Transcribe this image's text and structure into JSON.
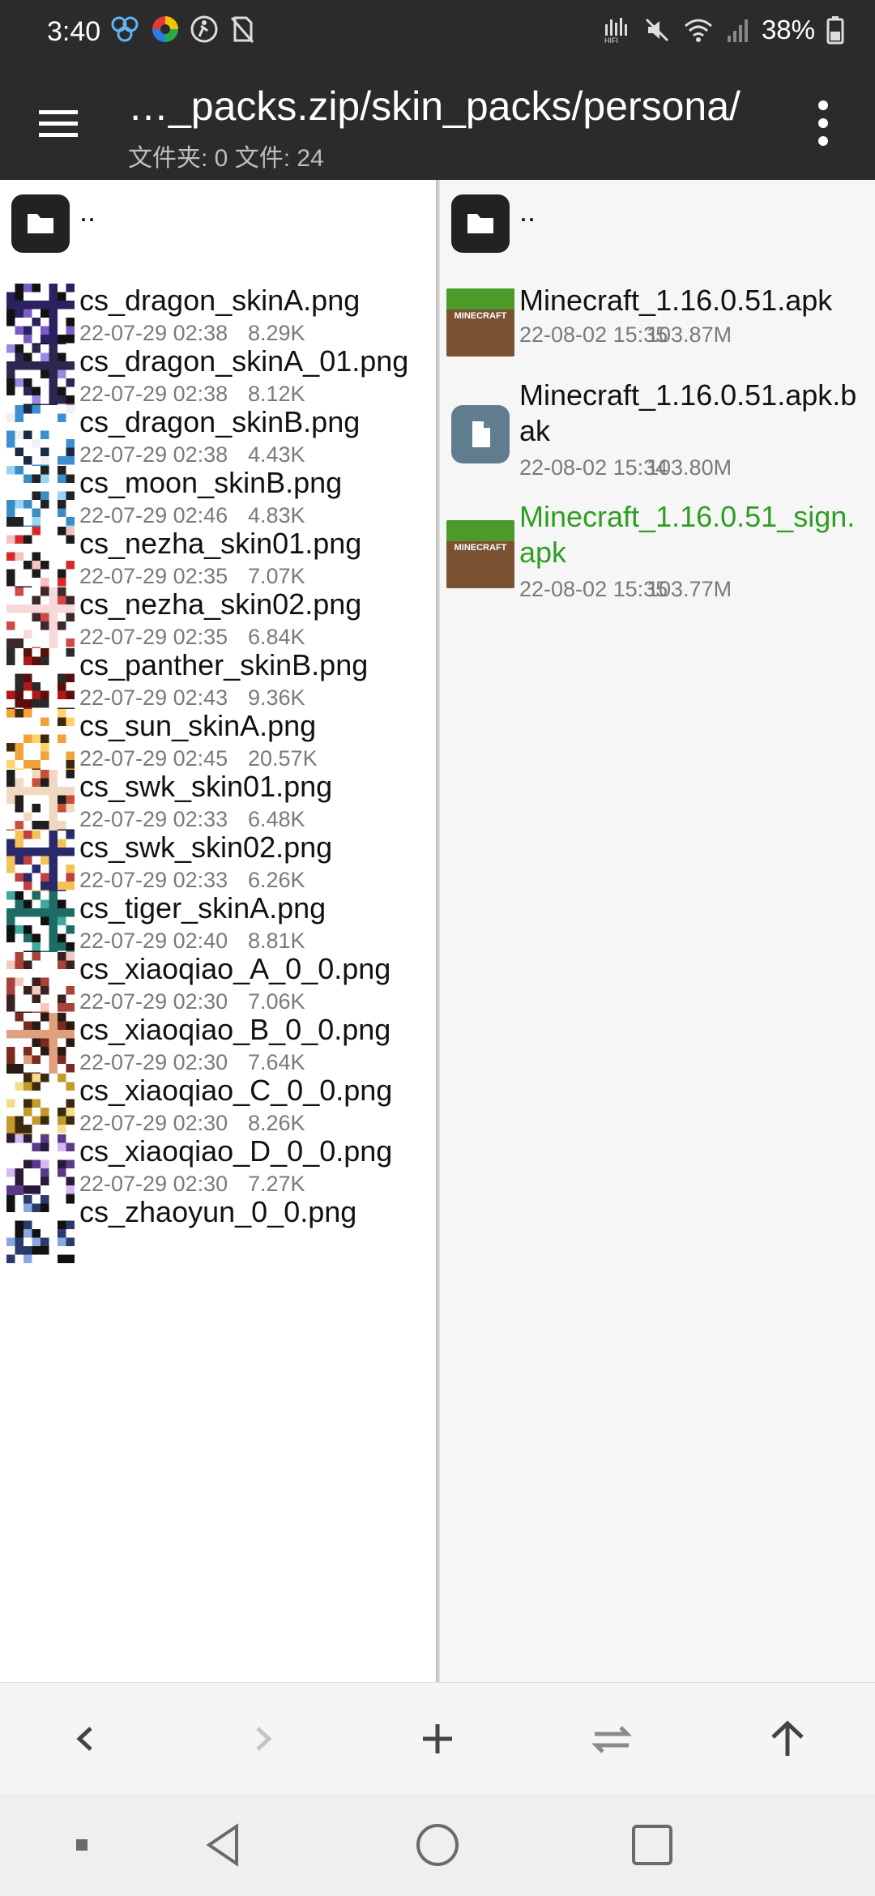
{
  "status_bar": {
    "time": "3:40",
    "battery": "38%",
    "icons_left": [
      "bubbles-icon",
      "color-wheel-icon",
      "accessibility-icon",
      "no-sim-icon"
    ],
    "icons_right": [
      "hifi-signal-icon",
      "mute-icon",
      "wifi-icon",
      "cell-signal-icon",
      "battery-icon"
    ]
  },
  "app_bar": {
    "path": "…_packs.zip/skin_packs/persona/",
    "counts": "文件夹: 0  文件: 24"
  },
  "left_pane": {
    "parent": "..",
    "files": [
      {
        "name": "cs_dragon_skinA.png",
        "date": "22-07-29 02:38",
        "size": "8.29K"
      },
      {
        "name": "cs_dragon_skinA_01.png",
        "date": "22-07-29 02:38",
        "size": "8.12K"
      },
      {
        "name": "cs_dragon_skinB.png",
        "date": "22-07-29 02:38",
        "size": "4.43K"
      },
      {
        "name": "cs_moon_skinB.png",
        "date": "22-07-29 02:46",
        "size": "4.83K"
      },
      {
        "name": "cs_nezha_skin01.png",
        "date": "22-07-29 02:35",
        "size": "7.07K"
      },
      {
        "name": "cs_nezha_skin02.png",
        "date": "22-07-29 02:35",
        "size": "6.84K"
      },
      {
        "name": "cs_panther_skinB.png",
        "date": "22-07-29 02:43",
        "size": "9.36K"
      },
      {
        "name": "cs_sun_skinA.png",
        "date": "22-07-29 02:45",
        "size": "20.57K"
      },
      {
        "name": "cs_swk_skin01.png",
        "date": "22-07-29 02:33",
        "size": "6.48K"
      },
      {
        "name": "cs_swk_skin02.png",
        "date": "22-07-29 02:33",
        "size": "6.26K"
      },
      {
        "name": "cs_tiger_skinA.png",
        "date": "22-07-29 02:40",
        "size": "8.81K"
      },
      {
        "name": "cs_xiaoqiao_A_0_0.png",
        "date": "22-07-29 02:30",
        "size": "7.06K"
      },
      {
        "name": "cs_xiaoqiao_B_0_0.png",
        "date": "22-07-29 02:30",
        "size": "7.64K"
      },
      {
        "name": "cs_xiaoqiao_C_0_0.png",
        "date": "22-07-29 02:30",
        "size": "8.26K"
      },
      {
        "name": "cs_xiaoqiao_D_0_0.png",
        "date": "22-07-29 02:30",
        "size": "7.27K"
      },
      {
        "name": "cs_zhaoyun_0_0.png",
        "date": "",
        "size": ""
      }
    ]
  },
  "right_pane": {
    "parent": "..",
    "files": [
      {
        "name": "Minecraft_1.16.0.51.apk",
        "date": "22-08-02 15:35",
        "size": "103.87M",
        "icon": "minecraft-icon",
        "highlight": false
      },
      {
        "name": "Minecraft_1.16.0.51.apk.bak",
        "date": "22-08-02 15:34",
        "size": "103.80M",
        "icon": "document-icon",
        "highlight": false
      },
      {
        "name": "Minecraft_1.16.0.51_sign.apk",
        "date": "22-08-02 15:35",
        "size": "103.77M",
        "icon": "minecraft-icon",
        "highlight": true
      }
    ],
    "minecraft_logo_text": "MINECRAFT"
  },
  "toolbar": {
    "buttons": [
      "back-icon",
      "forward-icon",
      "add-icon",
      "swap-icon",
      "up-icon"
    ]
  },
  "nav_bar": {
    "buttons": [
      "menu-dot-icon",
      "nav-back-icon",
      "home-icon",
      "recents-icon"
    ]
  },
  "colors": {
    "topbar": "#2b2b2b",
    "highlight_text": "#2e9e22",
    "meta_text": "#7a7a7a"
  }
}
